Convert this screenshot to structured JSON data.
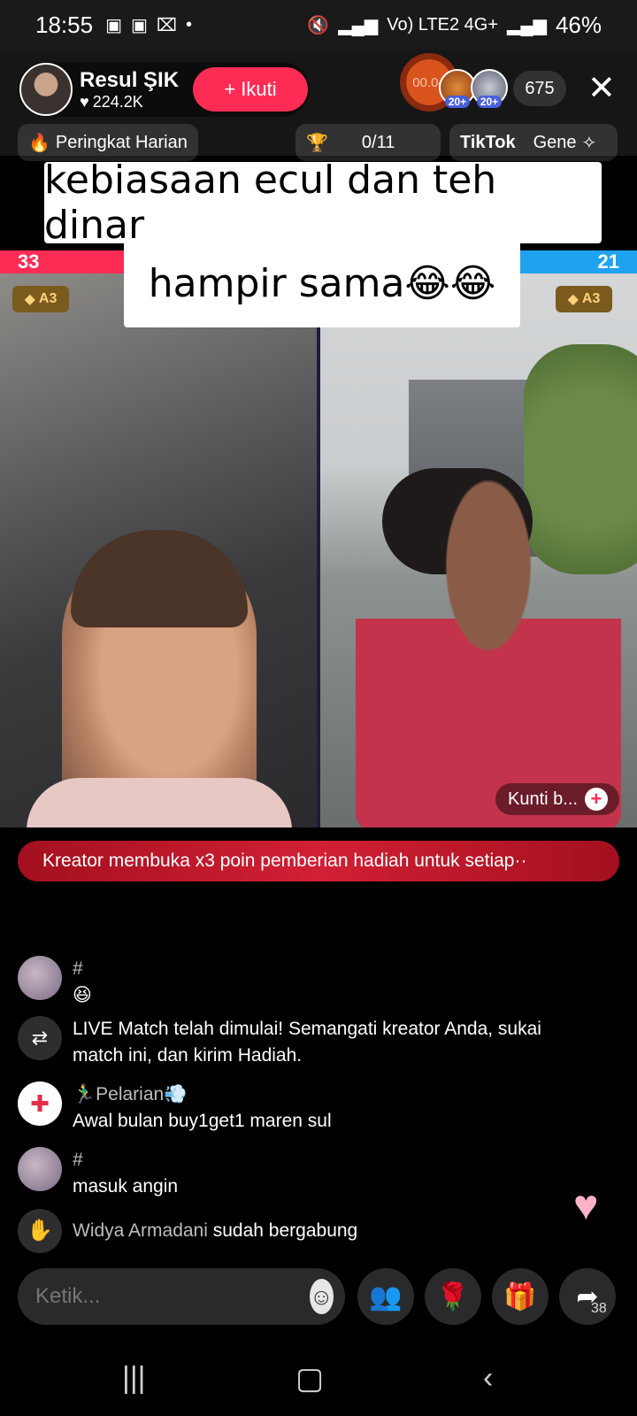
{
  "status_bar": {
    "time": "18:55",
    "left_icons": [
      "video-icon",
      "video-icon",
      "capcut-icon",
      "dot-icon"
    ],
    "network": "Vo) LTE2 4G+",
    "battery": "46%"
  },
  "host": {
    "name": "Resul ŞIK",
    "likes": "224.2K",
    "follow_label": "+ Ikuti"
  },
  "timer": "00.04",
  "viewers": {
    "avatar_levels": [
      "20+",
      "20+"
    ],
    "count": "675"
  },
  "tags": {
    "ranking": "Peringkat Harian",
    "goal": "0/11",
    "tiktok": "TikTok",
    "gene": "Gene"
  },
  "caption": {
    "line1": "kebiasaan ecul dan teh dinar",
    "line2": "hampir sama😂😂"
  },
  "battle": {
    "left_score": "33",
    "right_score": "21",
    "left_rank": "A3",
    "right_rank": "A3"
  },
  "guest_label": "Kunti b...",
  "notice": "Kreator membuka x3 poin pemberian hadiah untuk setiap··",
  "comments": [
    {
      "name": "#",
      "text": "😆"
    },
    {
      "name": "",
      "text": "LIVE Match telah dimulai! Semangati kreator Anda, sukai match ini, dan kirim Hadiah."
    },
    {
      "name": "🏃‍♂️Pelarian💨",
      "text": "Awal bulan buy1get1 maren sul"
    },
    {
      "name": "#",
      "text": "masuk angin"
    },
    {
      "name": "Widya Armadani",
      "text": "sudah bergabung"
    }
  ],
  "input": {
    "placeholder": "Ketik..."
  },
  "share_count": "38",
  "colors": {
    "accent": "#fe2c55",
    "blue_team": "#1fa2f0",
    "notice_red": "#d21f34"
  }
}
